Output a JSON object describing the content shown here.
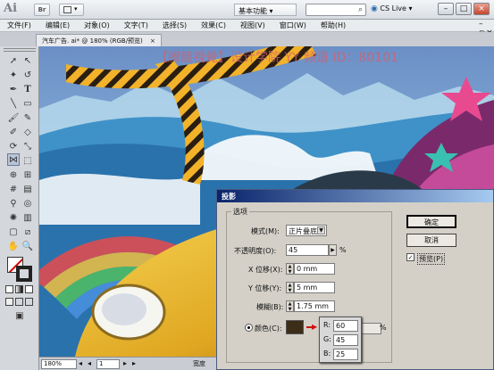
{
  "app": {
    "logo": "Ai",
    "bridge": "Br",
    "workspace": "基本功能 ▾",
    "cs_live": "CS Live ▾"
  },
  "menu": [
    "文件(F)",
    "编辑(E)",
    "对象(O)",
    "文字(T)",
    "选择(S)",
    "效果(C)",
    "视图(V)",
    "窗口(W)",
    "帮助(H)"
  ],
  "document": {
    "tab": "汽车广告. ai* @ 180% (RGB/预览)",
    "close": "×"
  },
  "watermark": "【腾龍視覺】设计学院  YY 频道 ID：80101",
  "status": {
    "zoom": "180%",
    "page": "1",
    "text": "宽度"
  },
  "dialog": {
    "title": "投影",
    "group": "选项",
    "mode_label": "模式(M):",
    "mode_value": "正片叠底",
    "opacity_label": "不透明度(O):",
    "opacity_value": "45",
    "opacity_unit": "%",
    "x_label": "X 位移(X):",
    "x_value": "0 mm",
    "y_label": "Y 位移(Y):",
    "y_value": "5 mm",
    "blur_label": "模糊(B):",
    "blur_value": "1.75 mm",
    "color_label": "颜色(C):",
    "darkness_unit": "%",
    "ok": "确定",
    "cancel": "取消",
    "preview": "预览(P)",
    "shadow_color": "#3c2d19",
    "rgb": {
      "r_label": "R:",
      "r": "60",
      "g_label": "G:",
      "g": "45",
      "b_label": "B:",
      "b": "25"
    }
  }
}
